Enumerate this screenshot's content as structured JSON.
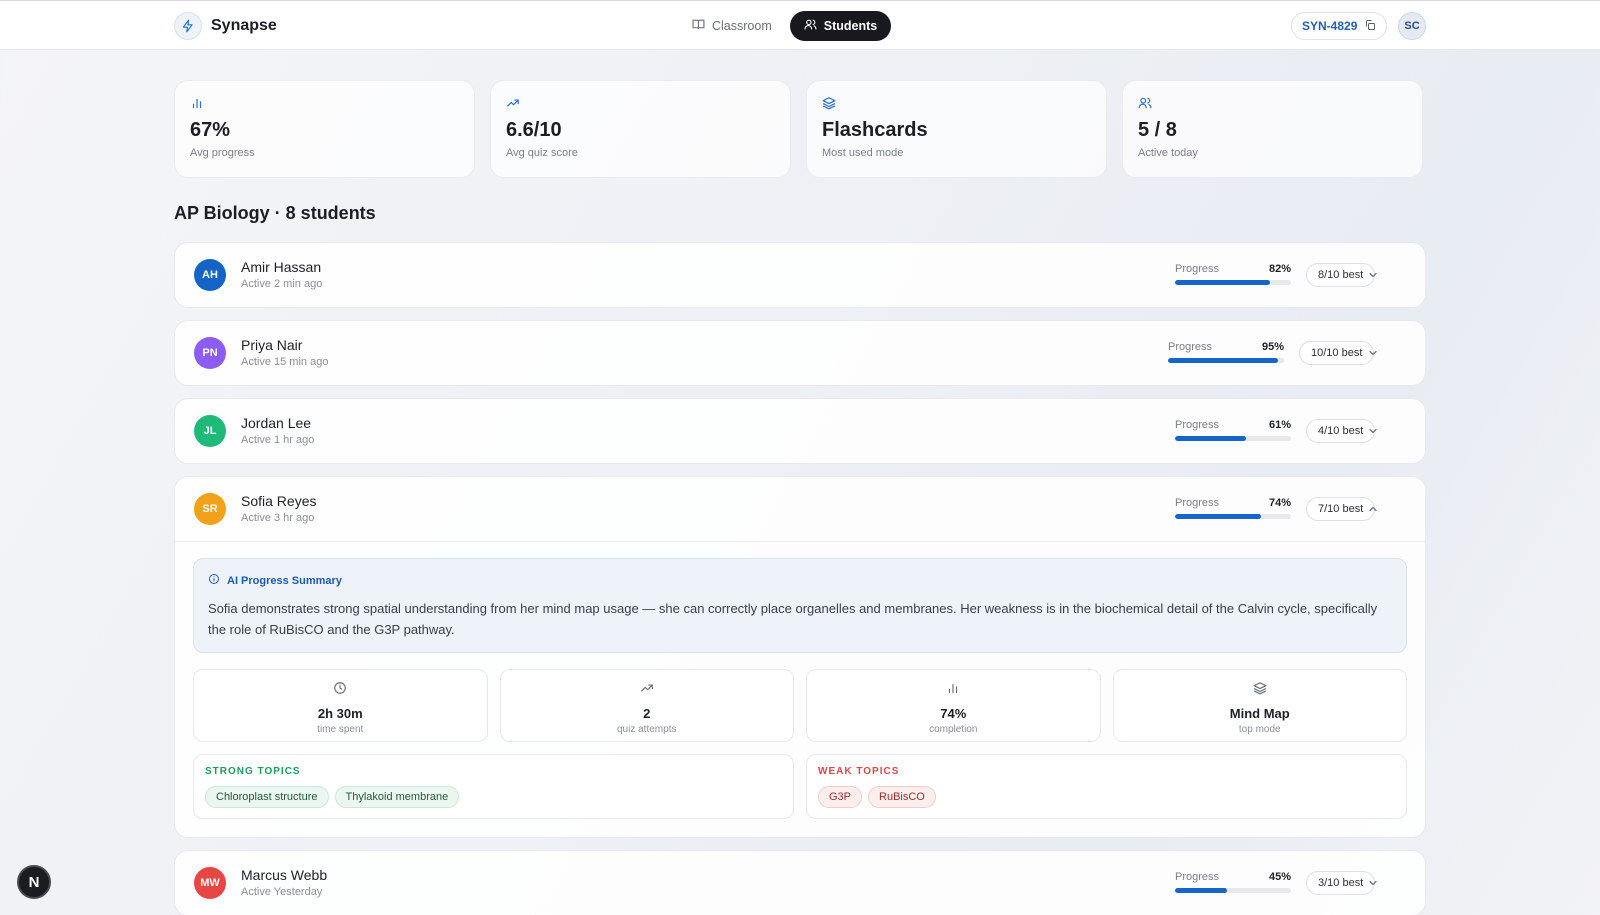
{
  "app": {
    "name": "Synapse",
    "tabs": [
      {
        "label": "Classroom",
        "active": false
      },
      {
        "label": "Students",
        "active": true
      }
    ],
    "class_code": "SYN-4829",
    "user_initials": "SC"
  },
  "stats": [
    {
      "icon": "bar-chart-icon",
      "value": "67%",
      "label": "Avg progress"
    },
    {
      "icon": "trending-up-icon",
      "value": "6.6/10",
      "label": "Avg quiz score"
    },
    {
      "icon": "layers-icon",
      "value": "Flashcards",
      "label": "Most used mode"
    },
    {
      "icon": "users-icon",
      "value": "5 / 8",
      "label": "Active today"
    }
  ],
  "section": {
    "title": "AP Biology · 8 students"
  },
  "progress_label": "Progress",
  "students": [
    {
      "initials": "AH",
      "name": "Amir Hassan",
      "active": "Active 2 min ago",
      "progress": 82,
      "progress_text": "82%",
      "best": "8/10 best",
      "color": "#1463c6",
      "expanded": false
    },
    {
      "initials": "PN",
      "name": "Priya Nair",
      "active": "Active 15 min ago",
      "progress": 95,
      "progress_text": "95%",
      "best": "10/10 best",
      "color": "#8b5cf6",
      "expanded": false
    },
    {
      "initials": "JL",
      "name": "Jordan Lee",
      "active": "Active 1 hr ago",
      "progress": 61,
      "progress_text": "61%",
      "best": "4/10 best",
      "color": "#1fb97a",
      "expanded": false
    },
    {
      "initials": "SR",
      "name": "Sofia Reyes",
      "active": "Active 3 hr ago",
      "progress": 74,
      "progress_text": "74%",
      "best": "7/10 best",
      "color": "#f2a11a",
      "expanded": true
    },
    {
      "initials": "MW",
      "name": "Marcus Webb",
      "active": "Active Yesterday",
      "progress": 45,
      "progress_text": "45%",
      "best": "3/10 best",
      "color": "#e84545",
      "expanded": false
    }
  ],
  "detail": {
    "summary_title": "AI Progress Summary",
    "summary_text": "Sofia demonstrates strong spatial understanding from her mind map usage — she can correctly place organelles and membranes. Her weakness is in the biochemical detail of the Calvin cycle, specifically the role of RuBisCO and the G3P pathway.",
    "metrics": [
      {
        "icon": "clock-icon",
        "value": "2h 30m",
        "label": "time spent"
      },
      {
        "icon": "trending-up-icon",
        "value": "2",
        "label": "quiz attempts"
      },
      {
        "icon": "bar-chart-icon",
        "value": "74%",
        "label": "completion"
      },
      {
        "icon": "layers-icon",
        "value": "Mind Map",
        "label": "top mode"
      }
    ],
    "strong_title": "STRONG TOPICS",
    "strong": [
      "Chloroplast structure",
      "Thylakoid membrane"
    ],
    "weak_title": "WEAK TOPICS",
    "weak": [
      "G3P",
      "RuBisCO"
    ]
  },
  "corner_badge": "N",
  "colors": {
    "accent": "#1665c8",
    "dark": "#17191f",
    "strong": "#1f9a5c",
    "weak": "#d94848"
  }
}
